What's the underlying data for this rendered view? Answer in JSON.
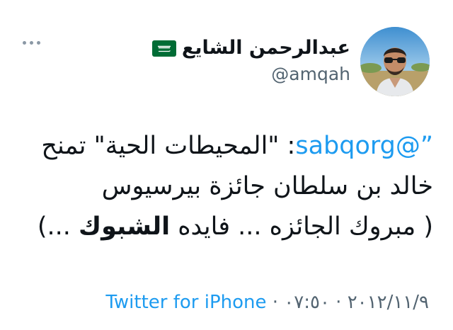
{
  "author": {
    "display_name": "عبدالرحمن الشايع",
    "handle": "@amqah",
    "flag_icon": "saudi-flag-icon",
    "avatar_icon": "profile-photo"
  },
  "menu": {
    "icon": "more-dots-icon"
  },
  "tweet": {
    "quote_open": "”",
    "mention": "@sabqorg",
    "line1_rest": ": \"المحيطات الحية\" تمنح",
    "line2": "خالد بن سلطان جائزة بيرسيوس",
    "line3_start": "( مبروك الجائزه ... فايده ",
    "line3_bold": "الشبوك",
    "line3_end": " ...)"
  },
  "meta": {
    "source": "Twitter for iPhone",
    "sep1": " · ",
    "time": "٠٧:٥٠",
    "sep2": " · ",
    "date": "٢٠١٢/١١/٩"
  },
  "colors": {
    "link": "#1d9bf0",
    "secondary": "#536471",
    "text": "#0f1419",
    "flag_green": "#006c35"
  }
}
